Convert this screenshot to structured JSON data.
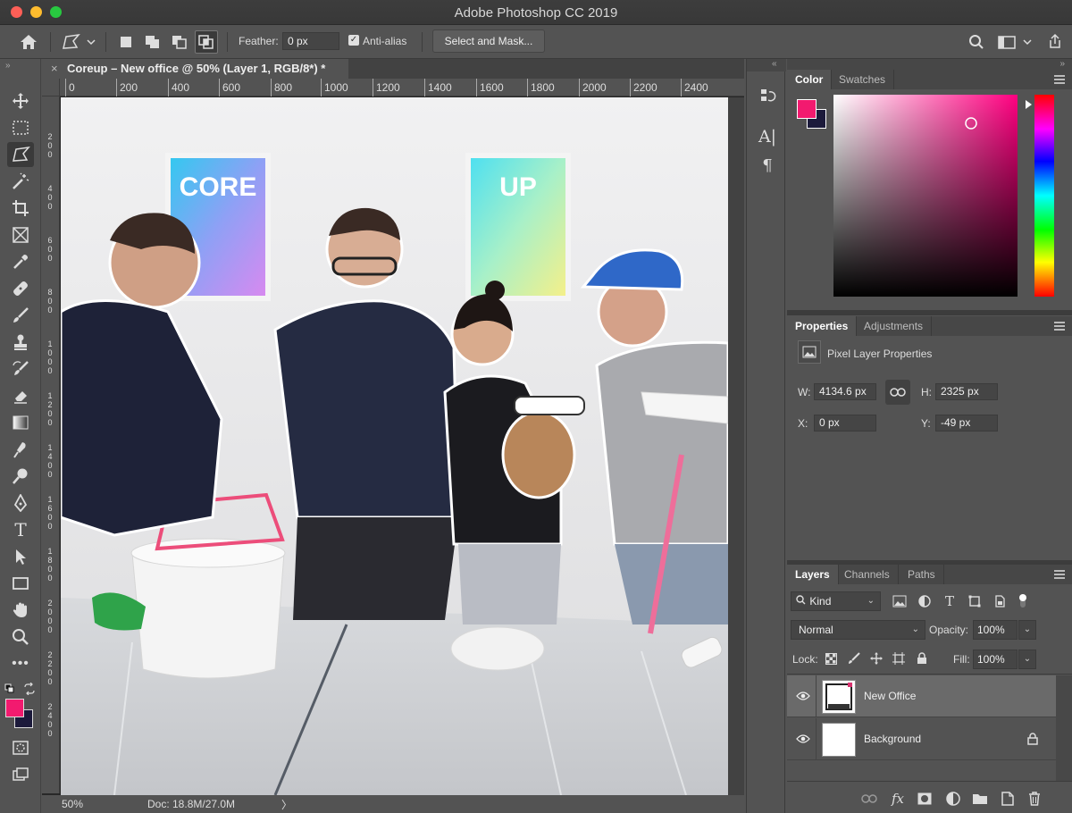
{
  "window": {
    "title": "Adobe Photoshop CC 2019"
  },
  "options_bar": {
    "feather_label": "Feather:",
    "feather_value": "0 px",
    "anti_alias_label": "Anti-alias",
    "anti_alias_checked": true,
    "select_and_mask_label": "Select and Mask..."
  },
  "document": {
    "tab_title": "Coreup – New office @ 50% (Layer 1, RGB/8*) *",
    "ruler_ticks": [
      "0",
      "200",
      "400",
      "600",
      "800",
      "1000",
      "1200",
      "1400",
      "1600",
      "1800",
      "2000",
      "2200",
      "2400"
    ],
    "left_ruler_labels": [
      "2\n0\n0",
      "4\n0\n0",
      "6\n0\n0",
      "8\n0\n0",
      "1\n0\n0\n0",
      "1\n2\n0\n0",
      "1\n4\n0\n0",
      "1\n6\n0\n0",
      "1\n8\n0\n0",
      "2\n0\n0\n0",
      "2\n2\n0\n0",
      "2\n4\n0\n0"
    ],
    "zoom": "50%",
    "doc_info": "Doc: 18.8M/27.0M",
    "poster_left_text": "CORE",
    "poster_right_text": "UP"
  },
  "color_panel": {
    "tabs": [
      "Color",
      "Swatches"
    ],
    "active_tab": "Color",
    "foreground": "#f21a6f",
    "background": "#1c1a3b"
  },
  "properties_panel": {
    "tabs": [
      "Properties",
      "Adjustments"
    ],
    "active_tab": "Properties",
    "title": "Pixel Layer Properties",
    "w_label": "W:",
    "w_value": "4134.6 px",
    "h_label": "H:",
    "h_value": "2325 px",
    "x_label": "X:",
    "x_value": "0 px",
    "y_label": "Y:",
    "y_value": "-49 px"
  },
  "layers_panel": {
    "tabs": [
      "Layers",
      "Channels",
      "Paths"
    ],
    "active_tab": "Layers",
    "filter_kind": "Kind",
    "blend_mode": "Normal",
    "opacity_label": "Opacity:",
    "opacity_value": "100%",
    "lock_label": "Lock:",
    "fill_label": "Fill:",
    "fill_value": "100%",
    "layers": [
      {
        "name": "New Office",
        "selected": true,
        "locked": false
      },
      {
        "name": "Background",
        "selected": false,
        "locked": true
      }
    ]
  }
}
